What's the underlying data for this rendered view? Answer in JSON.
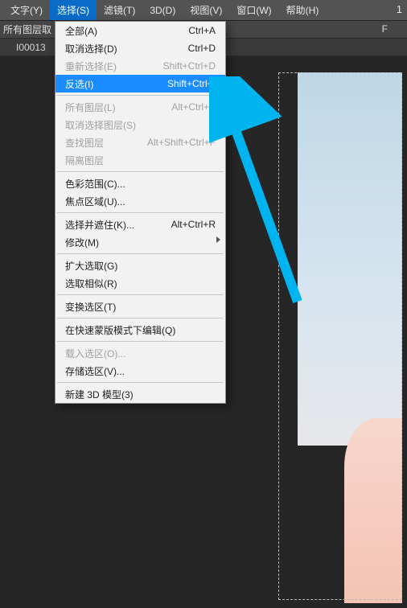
{
  "menubar": {
    "items": [
      "文字(Y)",
      "选择(S)",
      "滤镜(T)",
      "3D(D)",
      "视图(V)",
      "窗口(W)",
      "帮助(H)"
    ],
    "open_index": 1,
    "right_text": "1"
  },
  "subbar": {
    "label": "所有图层取",
    "right": "F"
  },
  "tab": {
    "label": "I00013"
  },
  "dropdown": {
    "highlight_index": 3,
    "rows": [
      {
        "type": "item",
        "label": "全部(A)",
        "shortcut": "Ctrl+A"
      },
      {
        "type": "item",
        "label": "取消选择(D)",
        "shortcut": "Ctrl+D"
      },
      {
        "type": "item",
        "label": "重新选择(E)",
        "shortcut": "Shift+Ctrl+D",
        "disabled": true
      },
      {
        "type": "item",
        "label": "反选(I)",
        "shortcut": "Shift+Ctrl+I"
      },
      {
        "type": "sep"
      },
      {
        "type": "item",
        "label": "所有图层(L)",
        "shortcut": "Alt+Ctrl+A",
        "disabled": true
      },
      {
        "type": "item",
        "label": "取消选择图层(S)",
        "disabled": true
      },
      {
        "type": "item",
        "label": "查找图层",
        "shortcut": "Alt+Shift+Ctrl+F",
        "disabled": true
      },
      {
        "type": "item",
        "label": "隔离图层",
        "disabled": true
      },
      {
        "type": "sep"
      },
      {
        "type": "item",
        "label": "色彩范围(C)..."
      },
      {
        "type": "item",
        "label": "焦点区域(U)..."
      },
      {
        "type": "sep"
      },
      {
        "type": "item",
        "label": "选择并遮住(K)...",
        "shortcut": "Alt+Ctrl+R"
      },
      {
        "type": "item",
        "label": "修改(M)",
        "submenu": true
      },
      {
        "type": "sep"
      },
      {
        "type": "item",
        "label": "扩大选取(G)"
      },
      {
        "type": "item",
        "label": "选取相似(R)"
      },
      {
        "type": "sep"
      },
      {
        "type": "item",
        "label": "变换选区(T)"
      },
      {
        "type": "sep"
      },
      {
        "type": "item",
        "label": "在快速蒙版模式下编辑(Q)"
      },
      {
        "type": "sep"
      },
      {
        "type": "item",
        "label": "载入选区(O)...",
        "disabled": true
      },
      {
        "type": "item",
        "label": "存储选区(V)..."
      },
      {
        "type": "sep"
      },
      {
        "type": "item",
        "label": "新建 3D 模型(3)"
      }
    ]
  },
  "annotation_color": "#00b4f0"
}
